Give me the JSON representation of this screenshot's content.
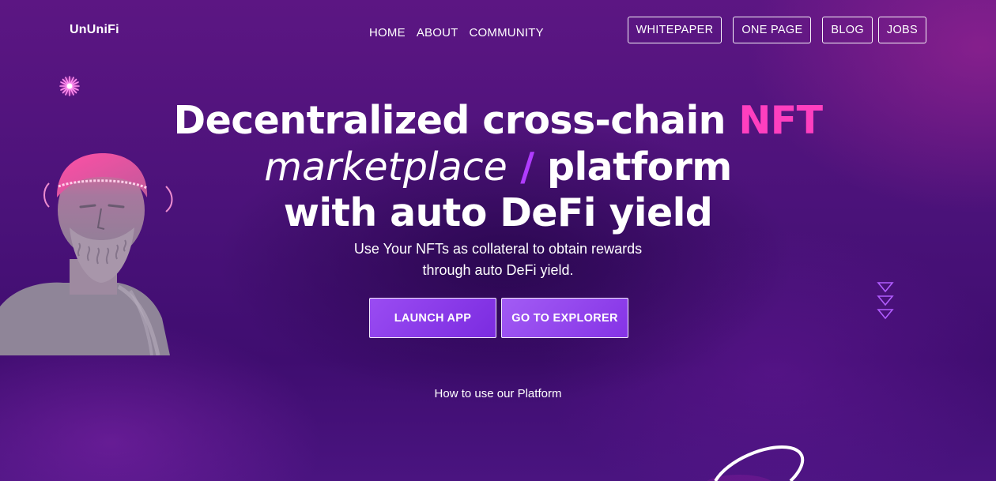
{
  "header": {
    "logo": "UnUniFi",
    "nav": [
      "HOME",
      "ABOUT",
      "COMMUNITY"
    ],
    "outline_links": [
      "WHITEPAPER",
      "ONE PAGE",
      "BLOG",
      "JOBS"
    ]
  },
  "hero": {
    "title_line1_a": "Decentralized cross-chain ",
    "title_line1_b": "NFT",
    "title_line2_a": "marketplace",
    "title_line2_b": "/",
    "title_line2_c": "platform",
    "title_line3": "with auto DeFi yield",
    "subtitle_line1": "Use Your NFTs as collateral to obtain rewards",
    "subtitle_line2": "through auto DeFi yield.",
    "cta_primary": "LAUNCH APP",
    "cta_secondary": "GO TO EXPLORER"
  },
  "how_to": "How to use our Platform",
  "colors": {
    "accent_pink": "#ff3fbf",
    "accent_purple": "#b03cff",
    "button_purple": "#8a3aea",
    "background": "#4a1279"
  },
  "icons": {
    "sparkle": "sparkle-icon",
    "chevrons": "triple-chevron-down-icon",
    "orbit": "orbit-ring-icon",
    "bust": "statue-bust-image"
  }
}
